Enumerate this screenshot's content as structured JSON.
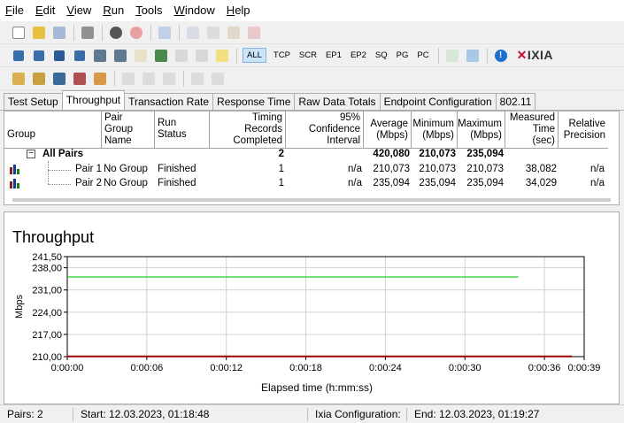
{
  "menu": [
    {
      "label": "File",
      "u": "F"
    },
    {
      "label": "Edit",
      "u": "E"
    },
    {
      "label": "View",
      "u": "V"
    },
    {
      "label": "Run",
      "u": "R"
    },
    {
      "label": "Tools",
      "u": "T"
    },
    {
      "label": "Window",
      "u": "W"
    },
    {
      "label": "Help",
      "u": "H"
    }
  ],
  "toolbar2": {
    "protocols": [
      "ALL",
      "TCP",
      "SCR",
      "EP1",
      "EP2",
      "SQ",
      "PG",
      "PC"
    ],
    "brand": "IXIA"
  },
  "tabs": [
    "Test Setup",
    "Throughput",
    "Transaction Rate",
    "Response Time",
    "Raw Data Totals",
    "Endpoint Configuration",
    "802.11"
  ],
  "active_tab": "Throughput",
  "grid": {
    "headers": [
      "Group",
      "Pair Group Name",
      "Run Status",
      "Timing Records Completed",
      "95% Confidence Interval",
      "Average (Mbps)",
      "Minimum (Mbps)",
      "Maximum (Mbps)",
      "Measured Time (sec)",
      "Relative Precision"
    ],
    "all_pairs": {
      "label": "All Pairs",
      "records": "2",
      "average": "420,080",
      "minimum": "210,073",
      "maximum": "235,094",
      "expander": "−"
    },
    "rows": [
      {
        "pair": "Pair 1",
        "group": "No Group",
        "status": "Finished",
        "records": "1",
        "ci": "n/a",
        "average": "210,073",
        "minimum": "210,073",
        "maximum": "210,073",
        "time": "38,082",
        "precision": "n/a"
      },
      {
        "pair": "Pair 2",
        "group": "No Group",
        "status": "Finished",
        "records": "1",
        "ci": "n/a",
        "average": "235,094",
        "minimum": "235,094",
        "maximum": "235,094",
        "time": "34,029",
        "precision": "n/a"
      }
    ]
  },
  "chart_data": {
    "type": "line",
    "title": "Throughput",
    "xlabel": "Elapsed time (h:mm:ss)",
    "ylabel": "Mbps",
    "ylim": [
      210,
      241.5
    ],
    "yticks": [
      "241,50",
      "238,00",
      "231,00",
      "224,00",
      "217,00",
      "210,00"
    ],
    "ytick_values": [
      241.5,
      238,
      231,
      224,
      217,
      210
    ],
    "xlim": [
      0,
      39
    ],
    "xticks": [
      "0:00:00",
      "0:00:06",
      "0:00:12",
      "0:00:18",
      "0:00:24",
      "0:00:30",
      "0:00:36",
      "0:00:39"
    ],
    "xtick_values": [
      0,
      6,
      12,
      18,
      24,
      30,
      36,
      39
    ],
    "grid": true,
    "series": [
      {
        "color": "#22cc22",
        "x": [
          0,
          34.029
        ],
        "y": [
          235.094,
          235.094
        ]
      },
      {
        "color": "#a00000",
        "x": [
          0,
          38.082
        ],
        "y": [
          210.073,
          210.073
        ]
      }
    ]
  },
  "status": {
    "pairs": "Pairs: 2",
    "start": "Start: 12.03.2023, 01:18:48",
    "ixia_config": "Ixia Configuration:",
    "end": "End: 12.03.2023, 01:19:27"
  }
}
